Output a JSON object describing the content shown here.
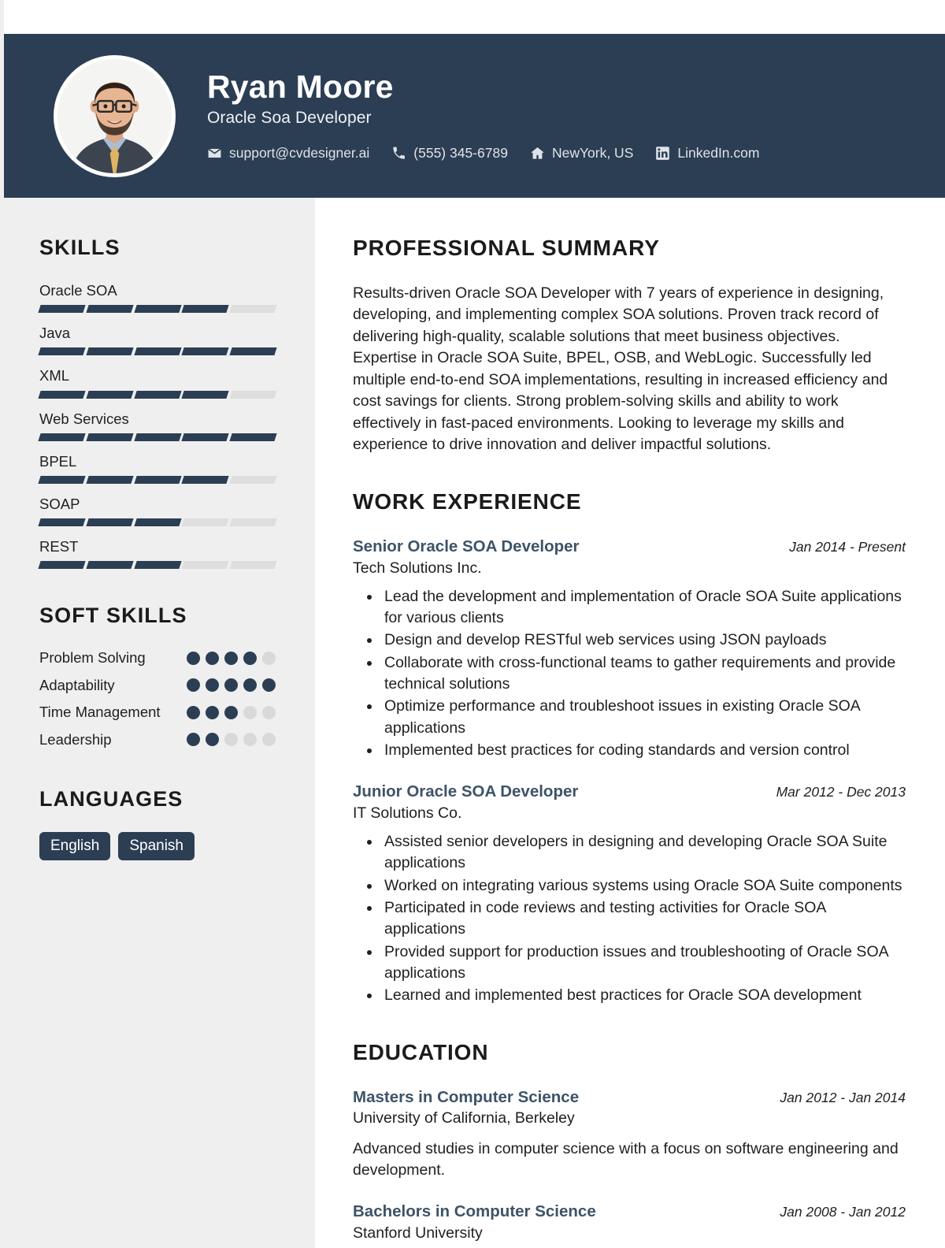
{
  "header": {
    "name": "Ryan Moore",
    "role": "Oracle Soa Developer",
    "contacts": [
      {
        "icon": "envelope-icon",
        "text": "support@cvdesigner.ai"
      },
      {
        "icon": "phone-icon",
        "text": "(555) 345-6789"
      },
      {
        "icon": "home-icon",
        "text": "NewYork, US"
      },
      {
        "icon": "linkedin-icon",
        "text": "LinkedIn.com"
      }
    ],
    "avatar_alt": "profile-photo"
  },
  "sidebar": {
    "skills_heading": "SKILLS",
    "skills": [
      {
        "name": "Oracle SOA",
        "level": 4,
        "max": 5
      },
      {
        "name": "Java",
        "level": 5,
        "max": 5
      },
      {
        "name": "XML",
        "level": 4,
        "max": 5
      },
      {
        "name": "Web Services",
        "level": 5,
        "max": 5
      },
      {
        "name": "BPEL",
        "level": 4,
        "max": 5
      },
      {
        "name": "SOAP",
        "level": 3,
        "max": 5
      },
      {
        "name": "REST",
        "level": 3,
        "max": 5
      }
    ],
    "soft_skills_heading": "SOFT SKILLS",
    "soft_skills": [
      {
        "name": "Problem Solving",
        "level": 4,
        "max": 5
      },
      {
        "name": "Adaptability",
        "level": 5,
        "max": 5
      },
      {
        "name": "Time Management",
        "level": 3,
        "max": 5
      },
      {
        "name": "Leadership",
        "level": 2,
        "max": 5
      }
    ],
    "languages_heading": "LANGUAGES",
    "languages": [
      "English",
      "Spanish"
    ]
  },
  "main": {
    "summary_heading": "PROFESSIONAL SUMMARY",
    "summary": "Results-driven Oracle SOA Developer with 7 years of experience in designing, developing, and implementing complex SOA solutions. Proven track record of delivering high-quality, scalable solutions that meet business objectives. Expertise in Oracle SOA Suite, BPEL, OSB, and WebLogic. Successfully led multiple end-to-end SOA implementations, resulting in increased efficiency and cost savings for clients. Strong problem-solving skills and ability to work effectively in fast-paced environments. Looking to leverage my skills and experience to drive innovation and deliver impactful solutions.",
    "experience_heading": "WORK EXPERIENCE",
    "experience": [
      {
        "title": "Senior Oracle SOA Developer",
        "date": "Jan 2014 - Present",
        "org": "Tech Solutions Inc.",
        "bullets": [
          "Lead the development and implementation of Oracle SOA Suite applications for various clients",
          "Design and develop RESTful web services using JSON payloads",
          "Collaborate with cross-functional teams to gather requirements and provide technical solutions",
          "Optimize performance and troubleshoot issues in existing Oracle SOA applications",
          "Implemented best practices for coding standards and version control"
        ]
      },
      {
        "title": "Junior Oracle SOA Developer",
        "date": "Mar 2012 - Dec 2013",
        "org": "IT Solutions Co.",
        "bullets": [
          "Assisted senior developers in designing and developing Oracle SOA Suite applications",
          "Worked on integrating various systems using Oracle SOA Suite components",
          "Participated in code reviews and testing activities for Oracle SOA applications",
          "Provided support for production issues and troubleshooting of Oracle SOA applications",
          "Learned and implemented best practices for Oracle SOA development"
        ]
      }
    ],
    "education_heading": "EDUCATION",
    "education": [
      {
        "title": "Masters in Computer Science",
        "date": "Jan 2012 - Jan 2014",
        "org": "University of California, Berkeley",
        "desc": "Advanced studies in computer science with a focus on software engineering and development."
      },
      {
        "title": "Bachelors in Computer Science",
        "date": "Jan 2008 - Jan 2012",
        "org": "Stanford University",
        "desc": ""
      }
    ]
  },
  "colors": {
    "header_bg": "#2b3e54",
    "sidebar_bg": "#efefef",
    "accent": "#3d5368",
    "bar_filled": "#2b3e54",
    "bar_empty": "#dedede",
    "text": "#1f1f1f"
  }
}
